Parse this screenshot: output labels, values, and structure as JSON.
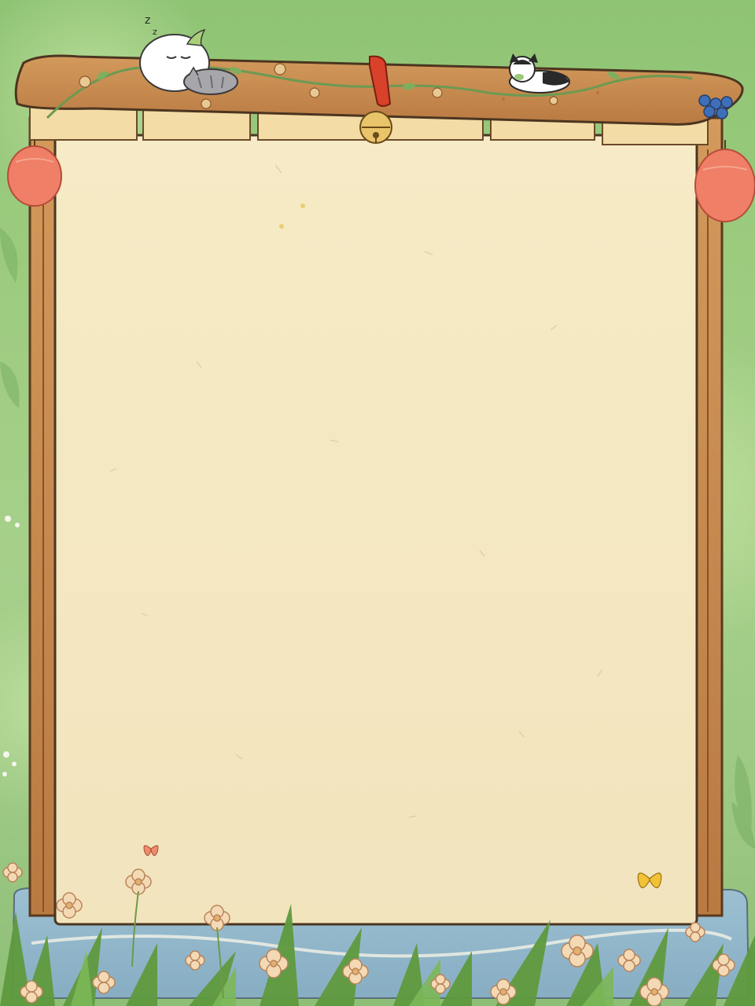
{
  "theme": {
    "background_green": "#9ccb7e",
    "paper_color": "#f5e9c4",
    "wood_color": "#c98b4f",
    "wood_dark": "#8a5128",
    "lantern_color": "#ef7f66",
    "bell_color": "#e9c46a",
    "ribbon_color": "#d9412b",
    "water_color": "#8fb3c9"
  },
  "decorations": {
    "left_lantern": "lantern-icon",
    "right_lantern": "lantern-icon",
    "bell": "bell-icon",
    "sleeping_cats": "cat-icon",
    "black_white_cat": "cat-icon",
    "berries": "berry-icon",
    "butterfly_orange": "butterfly-icon",
    "butterfly_yellow": "butterfly-icon",
    "flowers": "flower-icon"
  }
}
